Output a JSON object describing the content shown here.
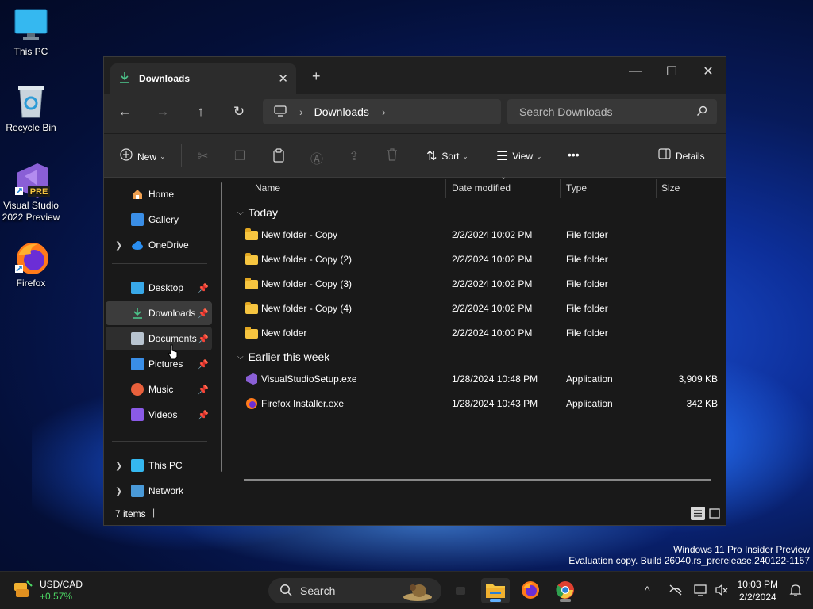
{
  "desktop": {
    "icons": [
      {
        "label": "This PC"
      },
      {
        "label": "Recycle Bin"
      },
      {
        "label": "Visual Studio 2022 Preview",
        "badge": "PRE"
      },
      {
        "label": "Firefox"
      }
    ]
  },
  "window": {
    "tab_title": "Downloads",
    "controls": {
      "close_tab": "✕",
      "new_tab": "+",
      "minimize": "—",
      "maximize": "☐",
      "close": "✕"
    },
    "nav": {
      "back": "←",
      "forward": "→",
      "up": "↑",
      "refresh": "↻"
    },
    "address": {
      "separator": "›",
      "segment": "Downloads"
    },
    "search": {
      "placeholder": "Search Downloads"
    },
    "toolbar": {
      "new_label": "New",
      "sort_label": "Sort",
      "view_label": "View",
      "more_label": "•••",
      "details_label": "Details"
    },
    "sidebar": {
      "items": [
        {
          "label": "Home",
          "icon": "home-icon"
        },
        {
          "label": "Gallery",
          "icon": "gallery-icon"
        },
        {
          "label": "OneDrive",
          "icon": "onedrive-icon"
        },
        {
          "label": "Desktop",
          "icon": "desktop-folder-icon"
        },
        {
          "label": "Downloads",
          "icon": "downloads-folder-icon"
        },
        {
          "label": "Documents",
          "icon": "documents-folder-icon"
        },
        {
          "label": "Pictures",
          "icon": "pictures-folder-icon"
        },
        {
          "label": "Music",
          "icon": "music-folder-icon"
        },
        {
          "label": "Videos",
          "icon": "videos-folder-icon"
        },
        {
          "label": "This PC",
          "icon": "this-pc-icon"
        },
        {
          "label": "Network",
          "icon": "network-icon"
        }
      ]
    },
    "columns": {
      "name": "Name",
      "date": "Date modified",
      "type": "Type",
      "size": "Size"
    },
    "groups": [
      {
        "title": "Today",
        "files": [
          {
            "name": "New folder - Copy",
            "date": "2/2/2024 10:02 PM",
            "type": "File folder",
            "size": ""
          },
          {
            "name": "New folder - Copy (2)",
            "date": "2/2/2024 10:02 PM",
            "type": "File folder",
            "size": ""
          },
          {
            "name": "New folder - Copy (3)",
            "date": "2/2/2024 10:02 PM",
            "type": "File folder",
            "size": ""
          },
          {
            "name": "New folder - Copy (4)",
            "date": "2/2/2024 10:02 PM",
            "type": "File folder",
            "size": ""
          },
          {
            "name": "New folder",
            "date": "2/2/2024 10:00 PM",
            "type": "File folder",
            "size": ""
          }
        ]
      },
      {
        "title": "Earlier this week",
        "files": [
          {
            "name": "VisualStudioSetup.exe",
            "date": "1/28/2024 10:48 PM",
            "type": "Application",
            "size": "3,909 KB"
          },
          {
            "name": "Firefox Installer.exe",
            "date": "1/28/2024 10:43 PM",
            "type": "Application",
            "size": "342 KB"
          }
        ]
      }
    ],
    "status": {
      "item_count": "7 items"
    }
  },
  "watermark": {
    "line1": "Windows 11 Pro Insider Preview",
    "line2": "Evaluation copy. Build 26040.rs_prerelease.240122-1157"
  },
  "taskbar": {
    "widget": {
      "title": "USD/CAD",
      "value": "+0.57%"
    },
    "search_label": "Search",
    "clock": {
      "time": "10:03 PM",
      "date": "2/2/2024"
    },
    "tray_chevron": "^"
  },
  "colors": {
    "accent": "#60b0ff",
    "folder": "#f6c540",
    "positive": "#4cd964"
  }
}
